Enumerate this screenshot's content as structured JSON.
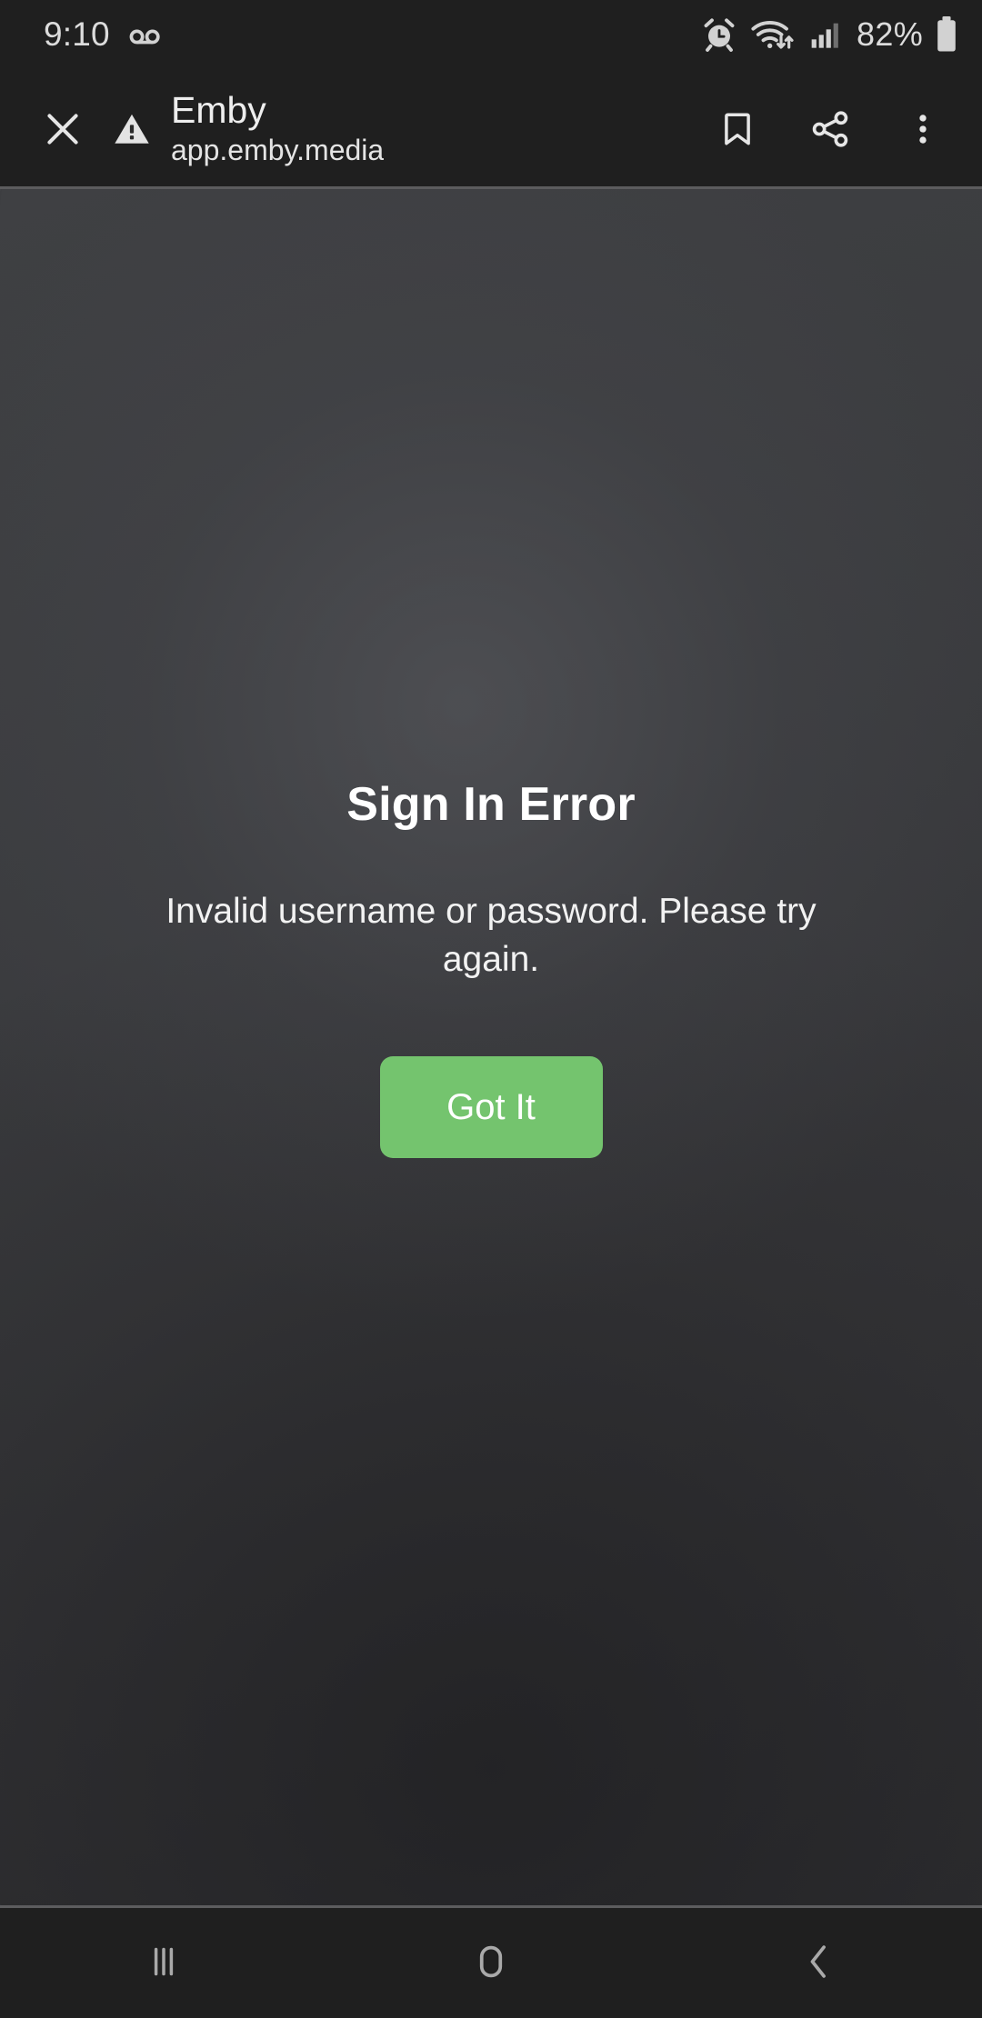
{
  "status_bar": {
    "time": "9:10",
    "battery_percent": "82%",
    "icons": [
      "voicemail-icon",
      "alarm-icon",
      "wifi-icon",
      "cellular-signal-icon",
      "battery-icon"
    ]
  },
  "browser_header": {
    "close_label": "close-icon",
    "security_label": "not-secure-warning-icon",
    "site_title": "Emby",
    "site_url": "app.emby.media",
    "actions": [
      "bookmark-icon",
      "share-icon",
      "overflow-menu-icon"
    ]
  },
  "dialog": {
    "title": "Sign In Error",
    "message": "Invalid username or password. Please try again.",
    "primary_button": "Got It",
    "accent_color": "#74c46e"
  },
  "nav_bar": {
    "recents_label": "recents-button",
    "home_label": "home-button",
    "back_label": "back-button"
  }
}
